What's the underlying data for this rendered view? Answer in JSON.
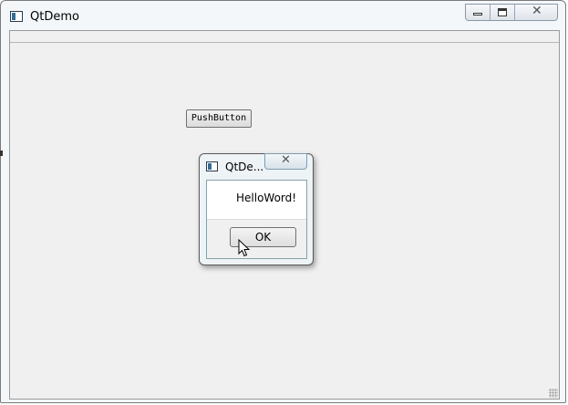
{
  "window": {
    "title": "QtDemo",
    "icon": "app-window-icon",
    "controls": [
      "minimize-icon",
      "maximize-icon",
      "close-icon"
    ]
  },
  "main": {
    "push_button_label": "PushButton"
  },
  "dialog": {
    "title": "QtDe...",
    "message": "HelloWord!",
    "ok_label": "OK",
    "close_icon": "close-icon"
  },
  "colors": {
    "client_bg": "#f0f0f0",
    "dialog_frame": "#eef3f5"
  }
}
